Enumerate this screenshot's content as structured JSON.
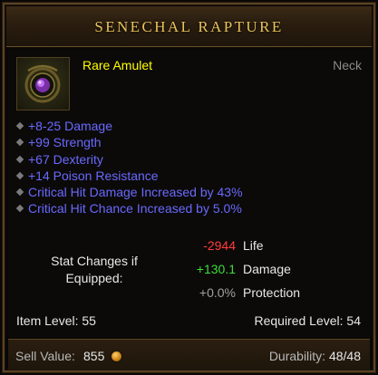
{
  "item": {
    "name": "SENECHAL RAPTURE",
    "quality_type": "Rare Amulet",
    "slot": "Neck",
    "icon": "amulet-icon"
  },
  "affixes": [
    "+8-25 Damage",
    "+99 Strength",
    "+67 Dexterity",
    "+14 Poison Resistance",
    "Critical Hit Damage Increased by 43%",
    "Critical Hit Chance Increased by 5.0%"
  ],
  "stat_changes": {
    "label_line1": "Stat Changes if",
    "label_line2": "Equipped:",
    "rows": [
      {
        "value": "-2944",
        "name": "Life",
        "color": "#ff3c3c"
      },
      {
        "value": "+130.1",
        "name": "Damage",
        "color": "#3cdc3c"
      },
      {
        "value": "+0.0%",
        "name": "Protection",
        "color": "#a0a0a0"
      }
    ]
  },
  "levels": {
    "item_level": "Item Level: 55",
    "required_level": "Required Level: 54"
  },
  "footer": {
    "sell_label": "Sell Value:",
    "sell_value": "855",
    "durability_label": "Durability:",
    "durability_value": "48/48"
  },
  "colors": {
    "title": "#e8c25a",
    "item_name": "#ffff00",
    "affix": "#6969ff",
    "slot": "#8a8a8a"
  }
}
